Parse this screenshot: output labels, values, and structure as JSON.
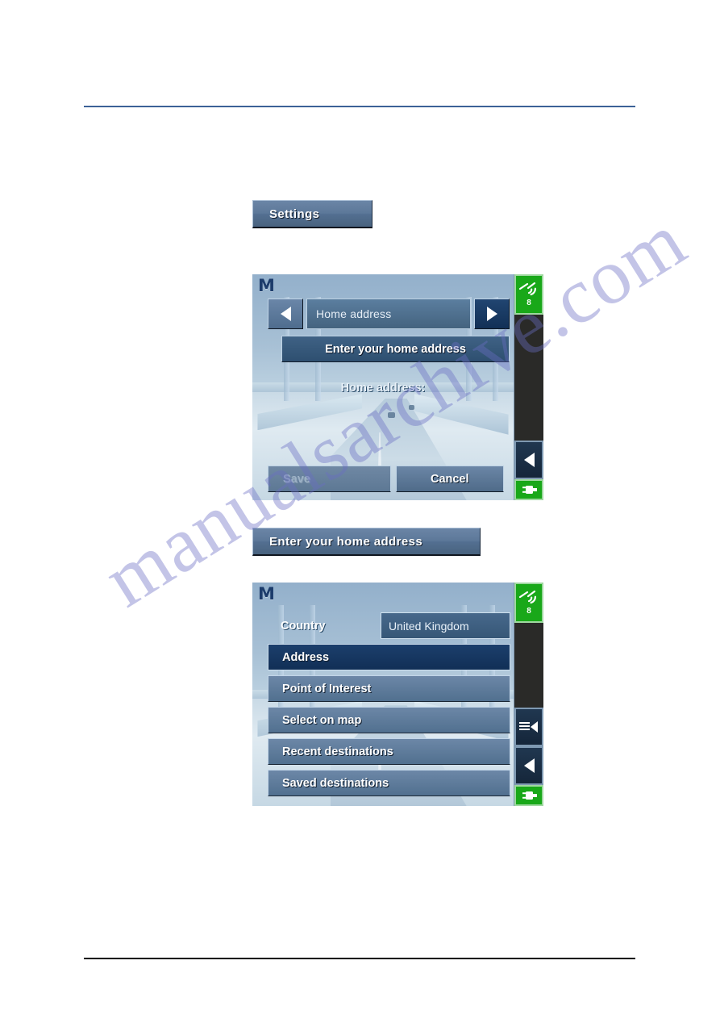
{
  "page": {
    "rules": {
      "top_color": "#3c6297",
      "bottom_color": "#000000"
    },
    "watermark": "manualsarchive.com"
  },
  "doc_buttons": {
    "settings": "Settings",
    "enter_home_address": "Enter your home address"
  },
  "screen_home_address": {
    "logo": "M",
    "nav": {
      "prev_icon": "triangle-left-icon",
      "title": "Home address",
      "next_icon": "triangle-right-icon"
    },
    "action_button": "Enter your home address",
    "field_label": "Home address:",
    "field_value": "",
    "footer": {
      "save": "Save",
      "save_disabled": true,
      "cancel": "Cancel"
    },
    "sidebar": {
      "gps_icon": "satellite-icon",
      "gps_count": "8",
      "gps_color": "#19a819",
      "back_icon": "triangle-left-icon",
      "plug_icon": "power-plug-icon",
      "plug_color": "#19a819"
    }
  },
  "screen_destination_menu": {
    "logo": "M",
    "country": {
      "label": "Country",
      "value": "United Kingdom"
    },
    "menu_items": [
      {
        "label": "Address",
        "selected": true
      },
      {
        "label": "Point of Interest",
        "selected": false
      },
      {
        "label": "Select on map",
        "selected": false
      },
      {
        "label": "Recent destinations",
        "selected": false
      },
      {
        "label": "Saved destinations",
        "selected": false
      }
    ],
    "sidebar": {
      "gps_icon": "satellite-icon",
      "gps_count": "8",
      "gps_color": "#19a819",
      "menu_icon": "list-menu-icon",
      "back_icon": "triangle-left-icon",
      "plug_icon": "power-plug-icon",
      "plug_color": "#19a819"
    }
  }
}
